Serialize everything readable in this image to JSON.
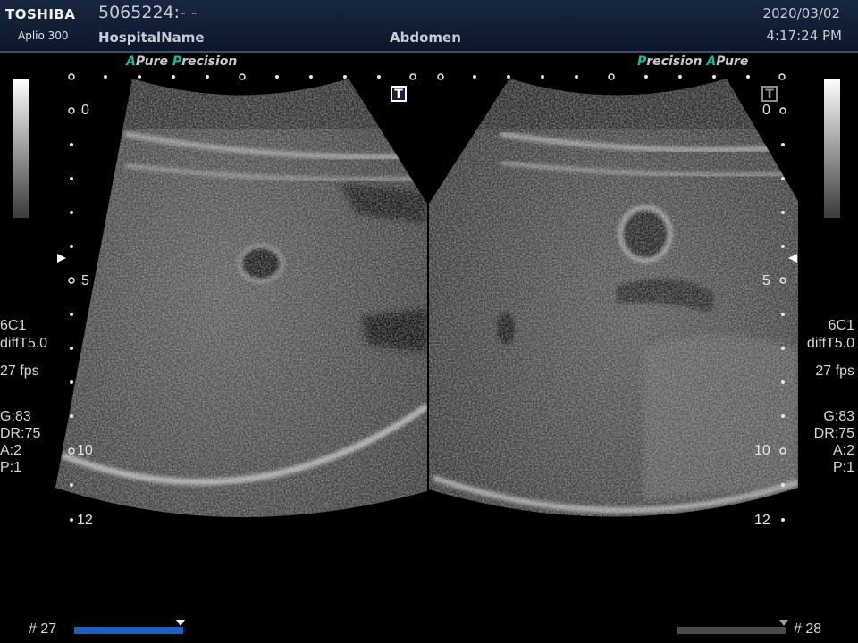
{
  "header": {
    "brand": "TOSHIBA",
    "model": "Aplio 300",
    "patient_id": "5065224:- -",
    "hospital": "HospitalName",
    "exam": "Abdomen",
    "date": "2020/03/02",
    "time": "4:17:24 PM"
  },
  "left_panel": {
    "tag_a": "A",
    "tag_pure": "Pure",
    "tag_p": "P",
    "tag_precision": "recision",
    "depth_labels": [
      "0",
      "5",
      "10",
      "12"
    ],
    "settings": {
      "probe": "6C1",
      "mode": "diffT5.0",
      "fps": "27 fps",
      "gain": "G:83",
      "dr": "DR:75",
      "a": "A:2",
      "p": "P:1"
    },
    "frame_label": "# 27",
    "tbox_label": "T"
  },
  "right_panel": {
    "tag_p": "P",
    "tag_precision": "recision",
    "tag_a": "A",
    "tag_pure": "Pure",
    "depth_labels": [
      "0",
      "5",
      "10",
      "12"
    ],
    "settings": {
      "probe": "6C1",
      "mode": "diffT5.0",
      "fps": "27 fps",
      "gain": "G:83",
      "dr": "DR:75",
      "a": "A:2",
      "p": "P:1"
    },
    "frame_label": "# 28",
    "tbox_label": "T"
  },
  "cine": {
    "left_progress": 1.0,
    "right_progress": 1.0
  },
  "colors": {
    "accent_teal": "#1cb7a0",
    "cine_blue": "#1b5fc0",
    "header_bg": "#13213a"
  }
}
